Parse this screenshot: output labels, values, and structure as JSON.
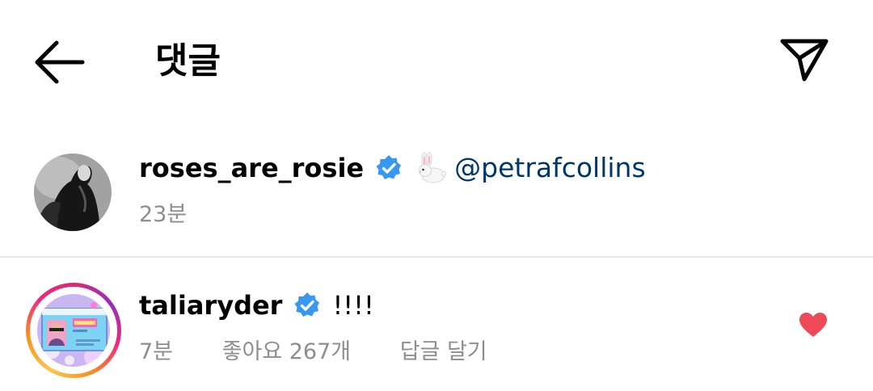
{
  "header": {
    "title": "댓글",
    "back_icon": "arrow-left-icon",
    "share_icon": "paper-plane-icon"
  },
  "caption": {
    "username": "roses_are_rosie",
    "verified": true,
    "emoji": "🐇",
    "mention": "@petrafcollins",
    "time": "23분"
  },
  "comments": [
    {
      "username": "taliaryder",
      "verified": true,
      "text": "!!!!",
      "time": "7분",
      "likes": "좋아요 267개",
      "reply": "답글 달기",
      "liked": true
    }
  ],
  "colors": {
    "verified_blue": "#3897f0",
    "mention_blue": "#00376b",
    "like_red": "#ed4956",
    "meta_gray": "#8e8e8e"
  }
}
